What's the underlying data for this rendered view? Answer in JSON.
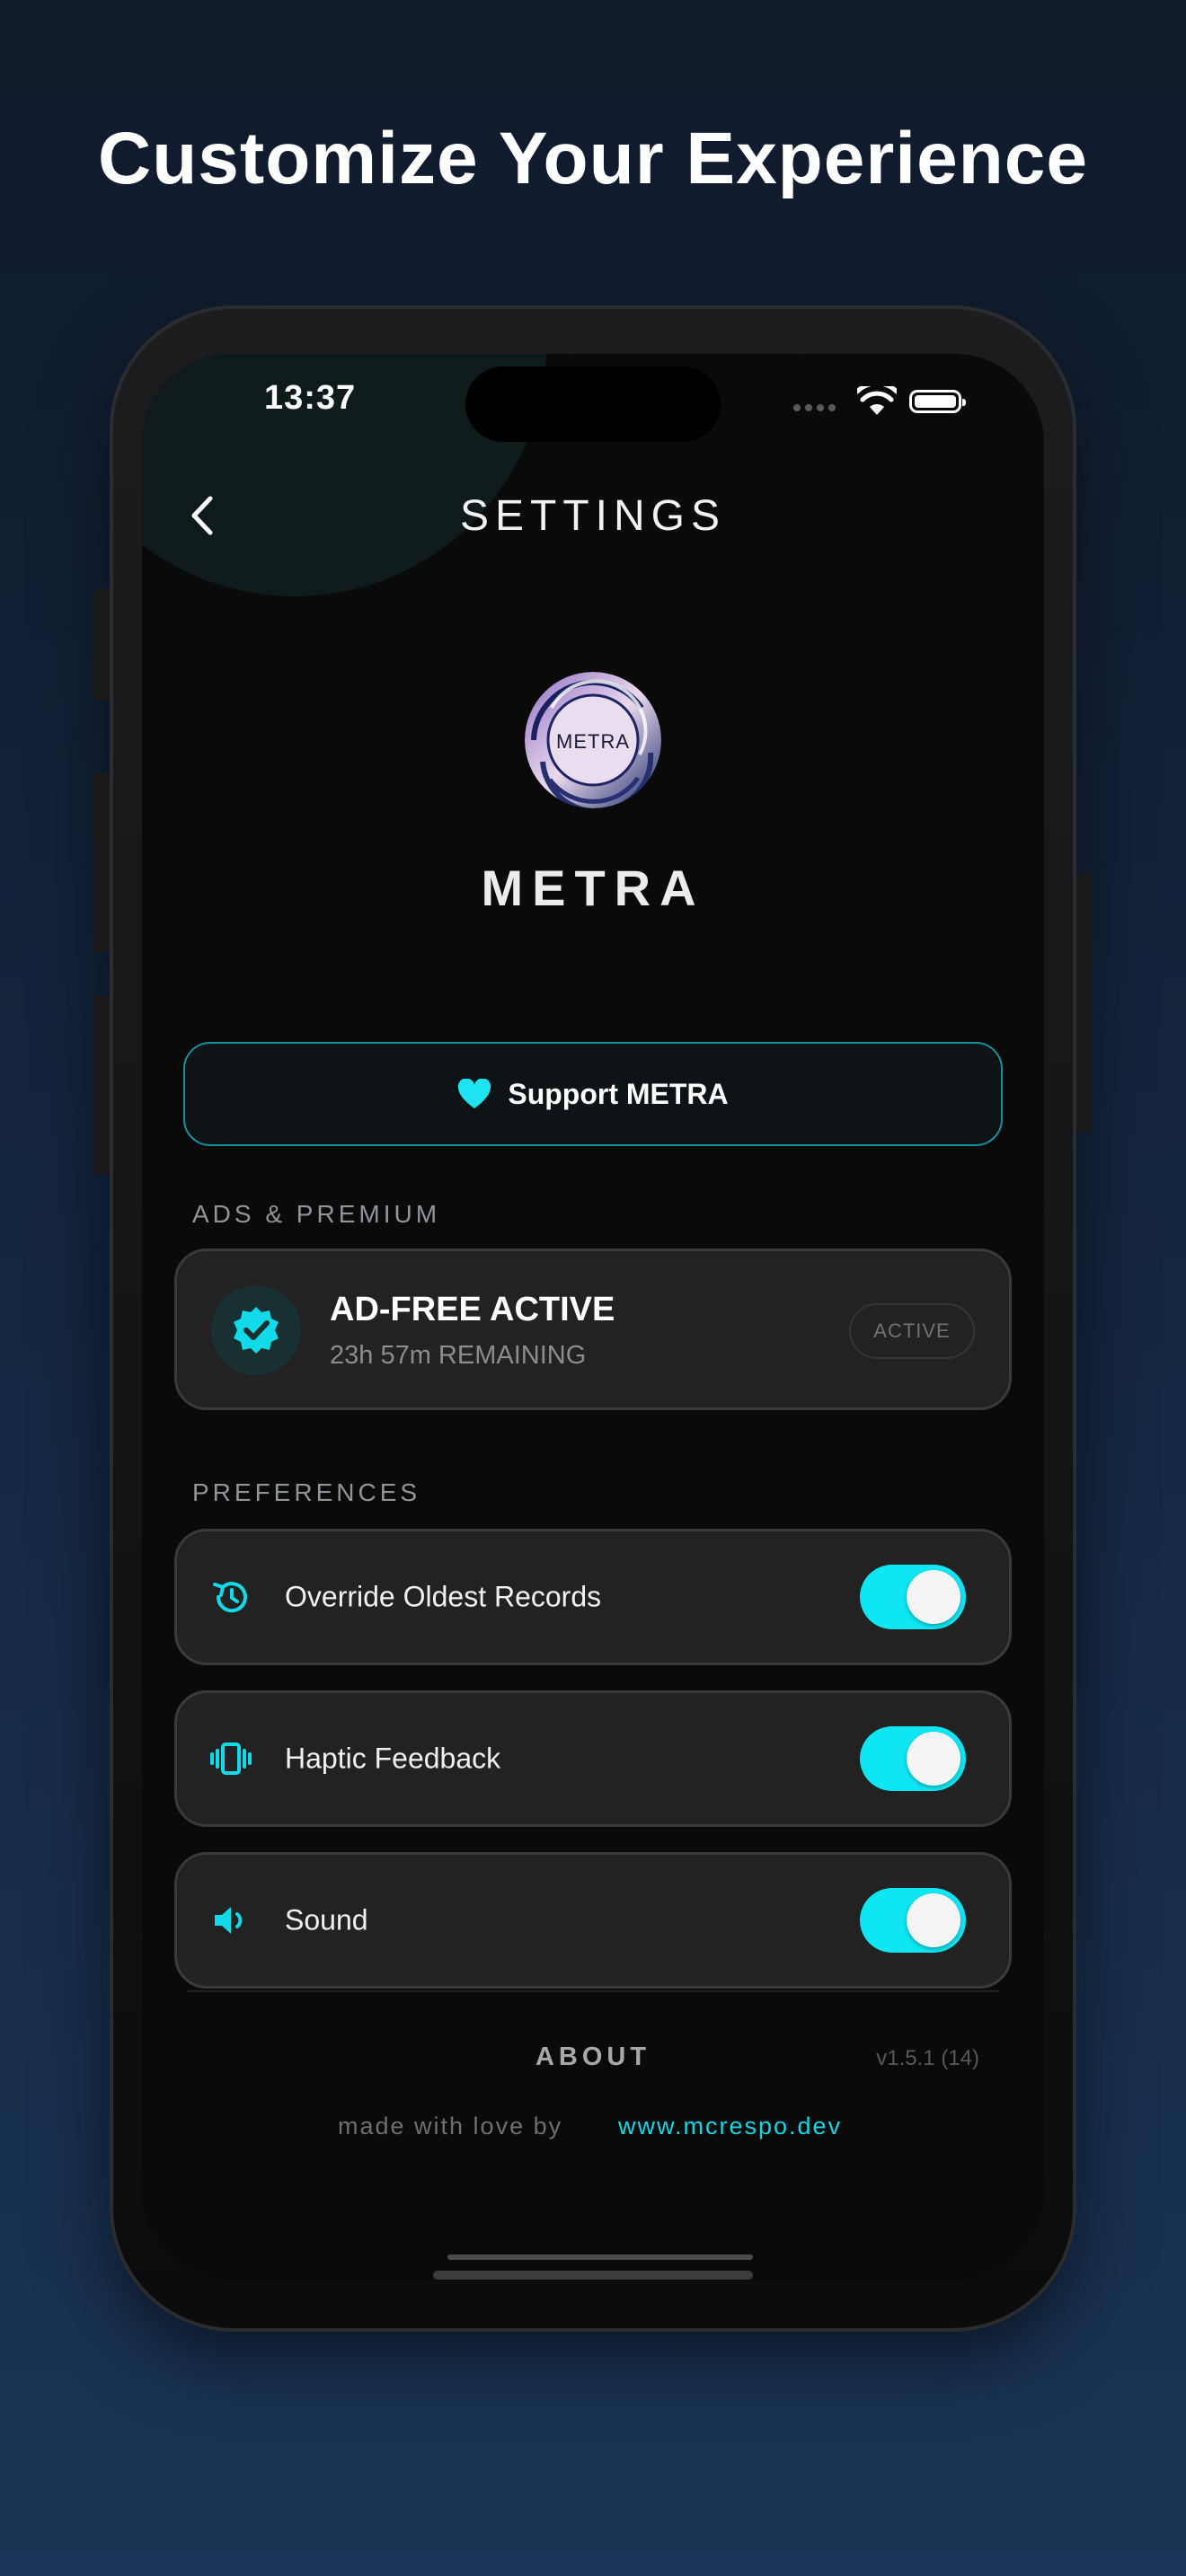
{
  "promo": {
    "headline": "Customize Your Experience"
  },
  "status_bar": {
    "time": "13:37"
  },
  "nav": {
    "title": "SETTINGS"
  },
  "app": {
    "logo_text": "METRA",
    "name": "METRA"
  },
  "support": {
    "label": "Support METRA"
  },
  "ads_section": {
    "label": "ADS & PREMIUM",
    "title": "AD-FREE ACTIVE",
    "subtitle": "23h 57m REMAINING",
    "badge": "ACTIVE"
  },
  "preferences": {
    "label": "PREFERENCES",
    "items": [
      {
        "label": "Override Oldest Records",
        "icon": "history-icon",
        "enabled": true
      },
      {
        "label": "Haptic Feedback",
        "icon": "vibration-icon",
        "enabled": true
      },
      {
        "label": "Sound",
        "icon": "speaker-icon",
        "enabled": true
      }
    ]
  },
  "about": {
    "title": "ABOUT",
    "version": "v1.5.1 (14)",
    "made_with": "made with love by",
    "website": "www.mcrespo.dev"
  },
  "colors": {
    "accent": "#0ee6f4",
    "background": "#0a0a0a",
    "card": "#222222"
  }
}
